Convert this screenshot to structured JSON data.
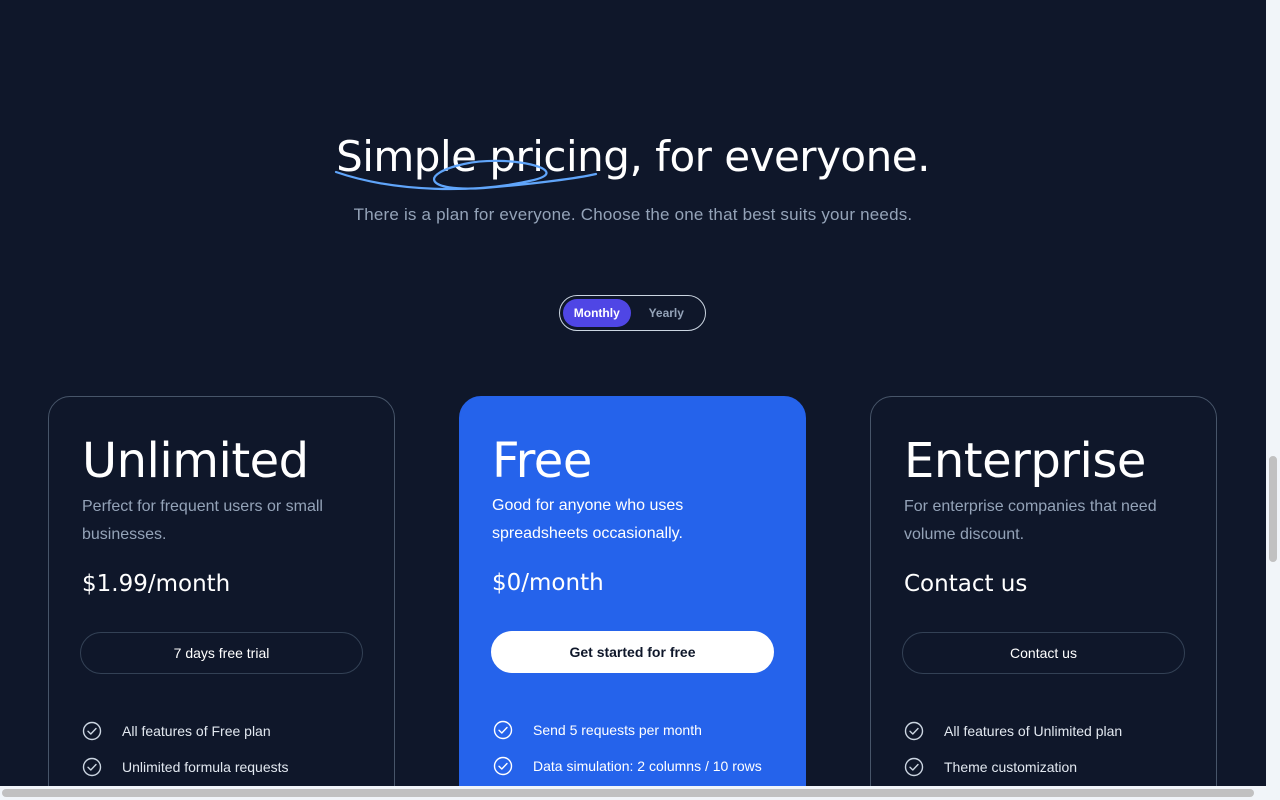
{
  "hero": {
    "title_highlight": "Simple pricing",
    "title_rest": ", for everyone.",
    "subtitle": "There is a plan for everyone. Choose the one that best suits your needs."
  },
  "billing_toggle": {
    "monthly": "Monthly",
    "yearly": "Yearly",
    "selected": "Monthly"
  },
  "plans": [
    {
      "name": "Unlimited",
      "description": "Perfect for frequent users or small businesses.",
      "price": "$1.99/month",
      "cta": "7 days free trial",
      "features": [
        "All features of Free plan",
        "Unlimited formula requests"
      ]
    },
    {
      "name": "Free",
      "description": "Good for anyone who uses spreadsheets occasionally.",
      "price": "$0/month",
      "cta": "Get started for free",
      "features": [
        "Send 5 requests per month",
        "Data simulation: 2 columns / 10 rows"
      ]
    },
    {
      "name": "Enterprise",
      "description": "For enterprise companies that need volume discount.",
      "price": "Contact us",
      "cta": "Contact us",
      "features": [
        "All features of Unlimited plan",
        "Theme customization"
      ]
    }
  ],
  "colors": {
    "background": "#0f172a",
    "featured_card": "#2563eb",
    "toggle_active": "#4f46e5",
    "scribble": "#60a5fa",
    "muted_text": "#94a3b8"
  },
  "icons": {
    "feature_check": "check-circle-icon",
    "title_decoration": "scribble-underline"
  }
}
